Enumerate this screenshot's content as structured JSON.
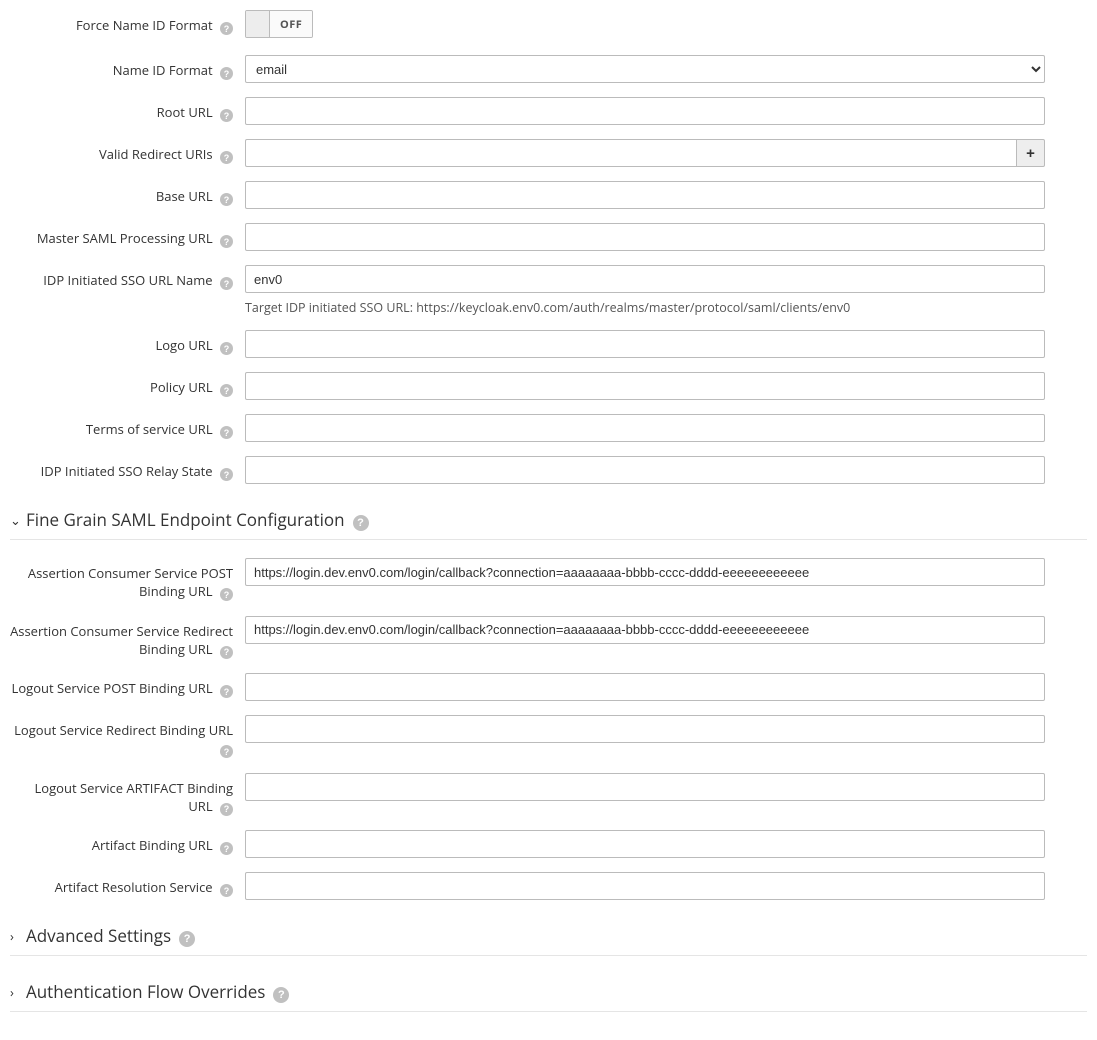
{
  "fields": {
    "force_name_id_format": {
      "label": "Force Name ID Format",
      "toggle": "OFF"
    },
    "name_id_format": {
      "label": "Name ID Format",
      "value": "email"
    },
    "root_url": {
      "label": "Root URL",
      "value": ""
    },
    "valid_redirect_uris": {
      "label": "Valid Redirect URIs",
      "value": ""
    },
    "base_url": {
      "label": "Base URL",
      "value": ""
    },
    "master_saml_processing_url": {
      "label": "Master SAML Processing URL",
      "value": ""
    },
    "idp_initiated_sso_url_name": {
      "label": "IDP Initiated SSO URL Name",
      "value": "env0",
      "helper": "Target IDP initiated SSO URL: https://keycloak.env0.com/auth/realms/master/protocol/saml/clients/env0"
    },
    "logo_url": {
      "label": "Logo URL",
      "value": ""
    },
    "policy_url": {
      "label": "Policy URL",
      "value": ""
    },
    "terms_of_service_url": {
      "label": "Terms of service URL",
      "value": ""
    },
    "idp_initiated_sso_relay_state": {
      "label": "IDP Initiated SSO Relay State",
      "value": ""
    }
  },
  "section_fine_grain": {
    "title": "Fine Grain SAML Endpoint Configuration",
    "fields": {
      "acs_post_binding_url": {
        "label": "Assertion Consumer Service POST Binding URL",
        "value": "https://login.dev.env0.com/login/callback?connection=aaaaaaaa-bbbb-cccc-dddd-eeeeeeeeeeee"
      },
      "acs_redirect_binding_url": {
        "label": "Assertion Consumer Service Redirect Binding URL",
        "value": "https://login.dev.env0.com/login/callback?connection=aaaaaaaa-bbbb-cccc-dddd-eeeeeeeeeeee"
      },
      "logout_post_binding_url": {
        "label": "Logout Service POST Binding URL",
        "value": ""
      },
      "logout_redirect_binding_url": {
        "label": "Logout Service Redirect Binding URL",
        "value": ""
      },
      "logout_artifact_binding_url": {
        "label": "Logout Service ARTIFACT Binding URL",
        "value": ""
      },
      "artifact_binding_url": {
        "label": "Artifact Binding URL",
        "value": ""
      },
      "artifact_resolution_service": {
        "label": "Artifact Resolution Service",
        "value": ""
      }
    }
  },
  "section_advanced": {
    "title": "Advanced Settings"
  },
  "section_auth_flow": {
    "title": "Authentication Flow Overrides"
  },
  "icons": {
    "add": "+"
  }
}
